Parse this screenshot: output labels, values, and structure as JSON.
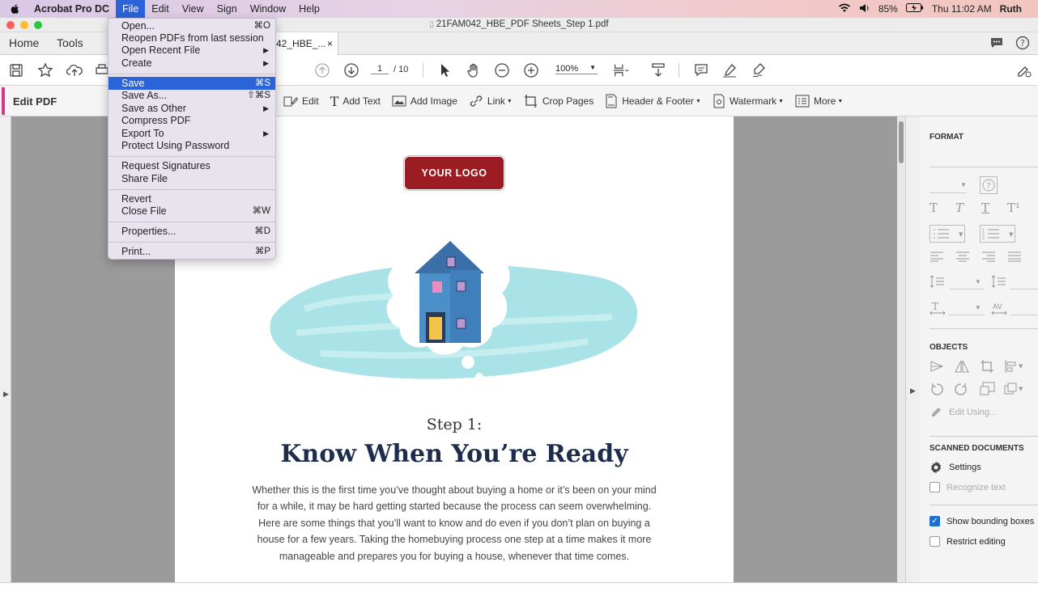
{
  "menubar": {
    "app_name": "Acrobat Pro DC",
    "items": [
      "File",
      "Edit",
      "View",
      "Sign",
      "Window",
      "Help"
    ],
    "battery": "85%",
    "clock": "Thu 11:02 AM",
    "user": "Ruth"
  },
  "window": {
    "title": "21FAM042_HBE_PDF Sheets_Step 1.pdf"
  },
  "tabs": {
    "home": "Home",
    "tools": "Tools",
    "document": "42_HBE_...",
    "close": "×"
  },
  "toolbar": {
    "page_current": "1",
    "page_total": "/ 10",
    "zoom": "100%"
  },
  "editbar": {
    "title": "Edit PDF",
    "tools": [
      "Edit",
      "Add Text",
      "Add Image",
      "Link",
      "Crop Pages",
      "Header & Footer",
      "Watermark",
      "More"
    ]
  },
  "document": {
    "logo": "YOUR LOGO",
    "step": "Step 1:",
    "headline": "Know When You’re Ready",
    "body_lines": [
      "Whether this is the first time you’ve thought about buying a home or it’s been on your mind",
      "for a while, it may be hard getting started because the process can seem overwhelming.",
      "Here are some things that you’ll want to know and do even if you don’t plan on buying a",
      "house for a few years. Taking the homebuying process one step at a time makes it more",
      "manageable and prepares you for buying a house, whenever that time comes."
    ]
  },
  "panel": {
    "format": "FORMAT",
    "objects": "OBJECTS",
    "edit_using": "Edit Using...",
    "scanned": "SCANNED DOCUMENTS",
    "settings": "Settings",
    "recognize": "Recognize text",
    "show_bounding": "Show bounding boxes",
    "restrict": "Restrict editing"
  },
  "file_menu": {
    "items": [
      {
        "label": "Open...",
        "shortcut": "⌘O"
      },
      {
        "label": "Reopen PDFs from last session",
        "shortcut": ""
      },
      {
        "label": "Open Recent File",
        "shortcut": "▶"
      },
      {
        "label": "Create",
        "shortcut": "▶"
      },
      {
        "label": "Save",
        "shortcut": "⌘S"
      },
      {
        "label": "Save As...",
        "shortcut": "⇧⌘S"
      },
      {
        "label": "Save as Other",
        "shortcut": "▶"
      },
      {
        "label": "Compress PDF",
        "shortcut": ""
      },
      {
        "label": "Export To",
        "shortcut": "▶"
      },
      {
        "label": "Protect Using Password",
        "shortcut": ""
      },
      {
        "label": "Request Signatures",
        "shortcut": ""
      },
      {
        "label": "Share File",
        "shortcut": ""
      },
      {
        "label": "Revert",
        "shortcut": ""
      },
      {
        "label": "Close File",
        "shortcut": "⌘W"
      },
      {
        "label": "Properties...",
        "shortcut": "⌘D"
      },
      {
        "label": "Print...",
        "shortcut": "⌘P"
      }
    ]
  },
  "colors": {
    "accent": "#2b63d9",
    "logo": "#9b1c22",
    "edit_accent": "#d43a8c",
    "headline": "#1f2d4d"
  }
}
